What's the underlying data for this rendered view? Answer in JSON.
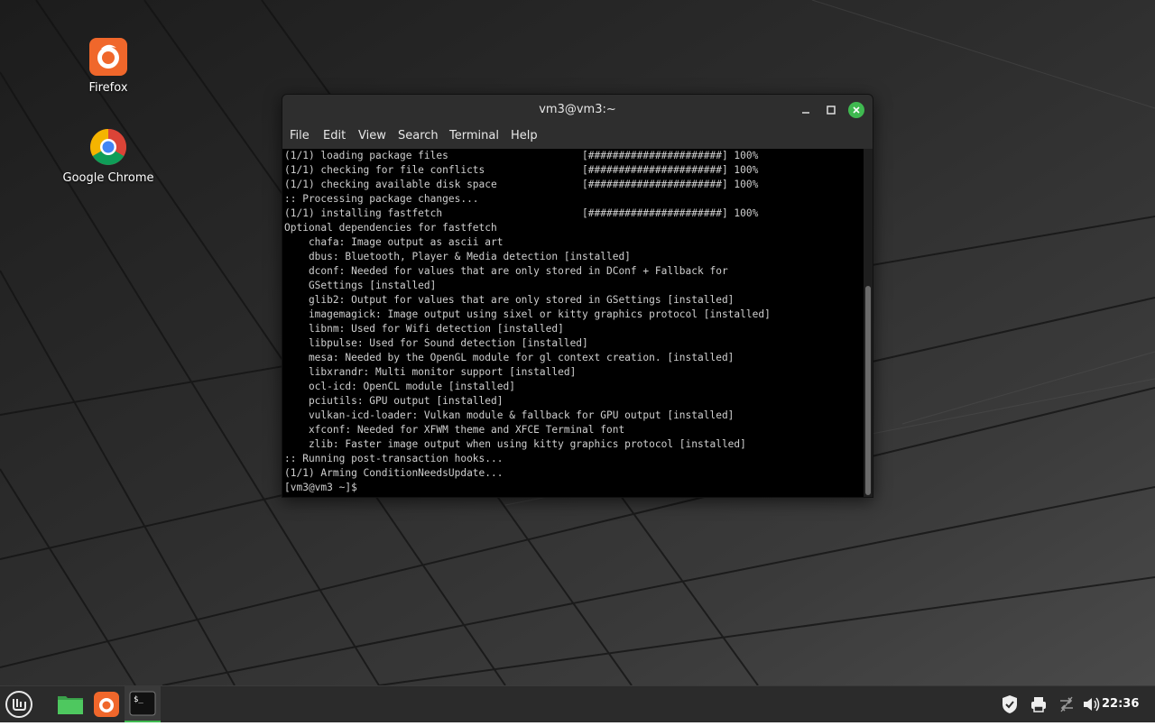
{
  "desktop": {
    "icons": [
      {
        "label": "Firefox",
        "icon": "firefox-icon"
      },
      {
        "label": "Google Chrome",
        "icon": "chrome-icon"
      }
    ]
  },
  "terminal": {
    "title": "vm3@vm3:~",
    "menu": [
      "File",
      "Edit",
      "View",
      "Search",
      "Terminal",
      "Help"
    ],
    "lines": [
      "(1/1) loading package files                      [######################] 100%",
      "(1/1) checking for file conflicts                [######################] 100%",
      "(1/1) checking available disk space              [######################] 100%",
      ":: Processing package changes...",
      "(1/1) installing fastfetch                       [######################] 100%",
      "Optional dependencies for fastfetch",
      "    chafa: Image output as ascii art",
      "    dbus: Bluetooth, Player & Media detection [installed]",
      "    dconf: Needed for values that are only stored in DConf + Fallback for",
      "    GSettings [installed]",
      "    glib2: Output for values that are only stored in GSettings [installed]",
      "    imagemagick: Image output using sixel or kitty graphics protocol [installed]",
      "    libnm: Used for Wifi detection [installed]",
      "    libpulse: Used for Sound detection [installed]",
      "    mesa: Needed by the OpenGL module for gl context creation. [installed]",
      "    libxrandr: Multi monitor support [installed]",
      "    ocl-icd: OpenCL module [installed]",
      "    pciutils: GPU output [installed]",
      "    vulkan-icd-loader: Vulkan module & fallback for GPU output [installed]",
      "    xfconf: Needed for XFWM theme and XFCE Terminal font",
      "    zlib: Faster image output when using kitty graphics protocol [installed]",
      ":: Running post-transaction hooks...",
      "(1/1) Arming ConditionNeedsUpdate...",
      "[vm3@vm3 ~]$"
    ]
  },
  "taskbar": {
    "launchers": [
      "menu-icon",
      "files-icon",
      "firefox-icon",
      "terminal-icon"
    ],
    "tray": [
      "shield-icon",
      "printer-icon",
      "network-icon",
      "volume-icon"
    ],
    "clock": "22:36"
  },
  "colors": {
    "accent_green": "#3fb950",
    "firefox_orange": "#f0672b",
    "taskbar": "#2b2b2b",
    "terminal_bg": "#000000"
  }
}
